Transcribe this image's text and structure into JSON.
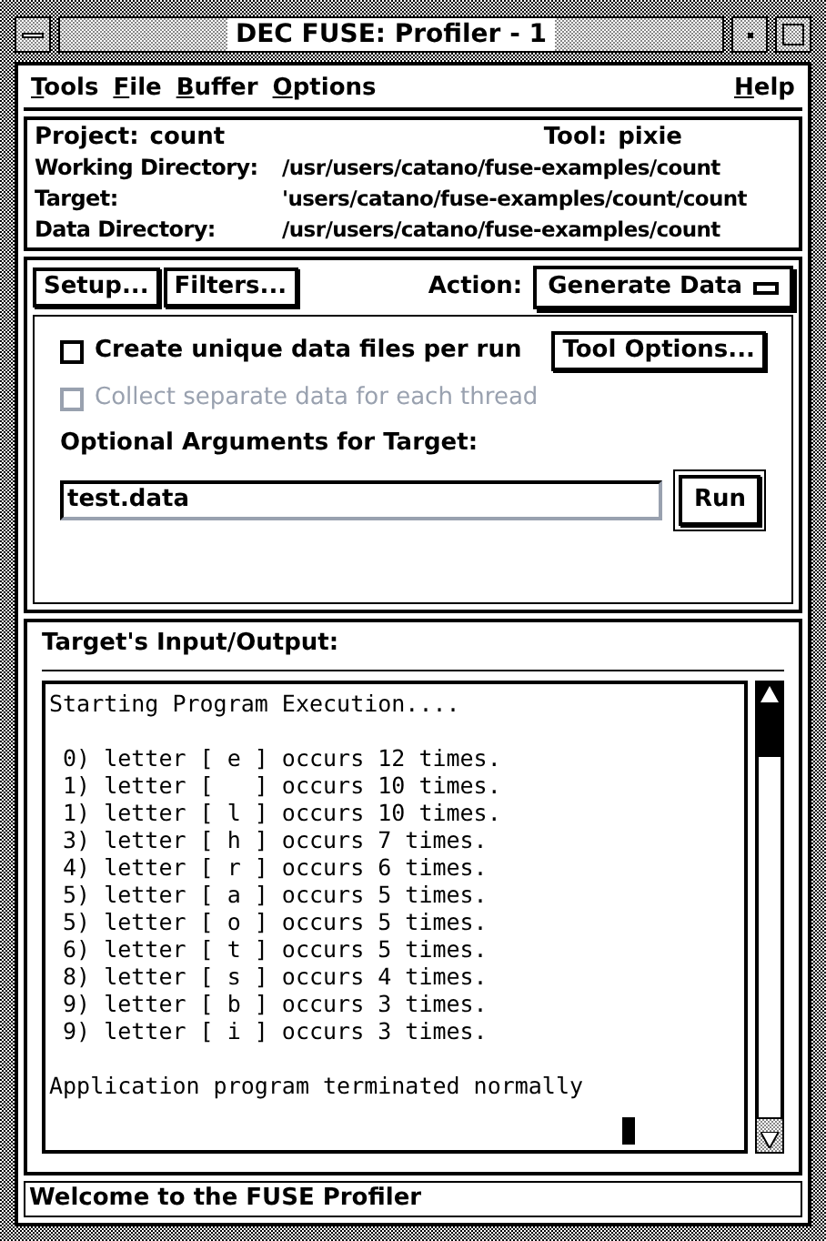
{
  "window": {
    "title": "DEC FUSE: Profiler - 1"
  },
  "menu": {
    "items": [
      {
        "label": "Tools"
      },
      {
        "label": "File"
      },
      {
        "label": "Buffer"
      },
      {
        "label": "Options"
      }
    ],
    "help": {
      "label": "Help"
    }
  },
  "info": {
    "project_label": "Project:",
    "project": "count",
    "tool_label": "Tool:",
    "tool": "pixie",
    "fields": [
      {
        "label": "Working Directory:",
        "value": "/usr/users/catano/fuse-examples/count"
      },
      {
        "label": "Target:",
        "value": "'users/catano/fuse-examples/count/count"
      },
      {
        "label": "Data Directory:",
        "value": "/usr/users/catano/fuse-examples/count"
      }
    ]
  },
  "actions": {
    "buttons": [
      "Setup...",
      "Filters..."
    ],
    "action_label": "Action:",
    "action_value": "Generate Data"
  },
  "options": {
    "checkboxes": [
      {
        "label": "Create unique data files per run",
        "checked": false,
        "disabled": false
      },
      {
        "label": "Collect separate data for each thread",
        "checked": false,
        "disabled": true
      }
    ],
    "tool_options": "Tool Options...",
    "args_label": "Optional Arguments for Target:",
    "args_value": "test.data",
    "run": "Run"
  },
  "io": {
    "title": "Target's Input/Output:",
    "header": "Starting Program Execution....",
    "lines": [
      " 0) letter [ e ] occurs 12 times.",
      " 1) letter [   ] occurs 10 times.",
      " 1) letter [ l ] occurs 10 times.",
      " 3) letter [ h ] occurs 7 times.",
      " 4) letter [ r ] occurs 6 times.",
      " 5) letter [ a ] occurs 5 times.",
      " 5) letter [ o ] occurs 5 times.",
      " 6) letter [ t ] occurs 5 times.",
      " 8) letter [ s ] occurs 4 times.",
      " 9) letter [ b ] occurs 3 times.",
      " 9) letter [ i ] occurs 3 times."
    ],
    "footer": "Application program terminated normally"
  },
  "status_bar": "Welcome to the FUSE Profiler"
}
